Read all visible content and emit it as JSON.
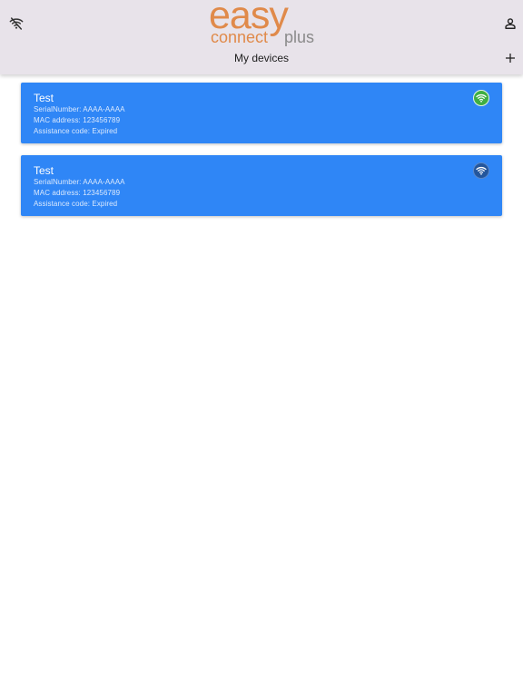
{
  "header": {
    "logo": {
      "easy": "easy",
      "connect": "connect",
      "plus": "plus"
    },
    "page_title": "My devices",
    "icons": {
      "left": "wifi-off-icon",
      "right_top": "account-icon",
      "right_bottom": "add-icon"
    }
  },
  "devices": [
    {
      "name": "Test",
      "serial": "SerialNumber: AAAA-AAAA",
      "mac": "MAC address: 123456789",
      "assistance": "Assistance code: Expired",
      "status_icon": "wifi-connected-icon",
      "status_color": "#3fae43"
    },
    {
      "name": "Test",
      "serial": "SerialNumber: AAAA-AAAA",
      "mac": "MAC address: 123456789",
      "assistance": "Assistance code: Expired",
      "status_icon": "wifi-disconnected-icon",
      "status_color": "#23569c"
    }
  ],
  "colors": {
    "header_bg": "#e8e3ea",
    "card_bg": "#2f86f6",
    "logo_orange": "#e08a4a",
    "logo_gray": "#8a8a8a"
  }
}
